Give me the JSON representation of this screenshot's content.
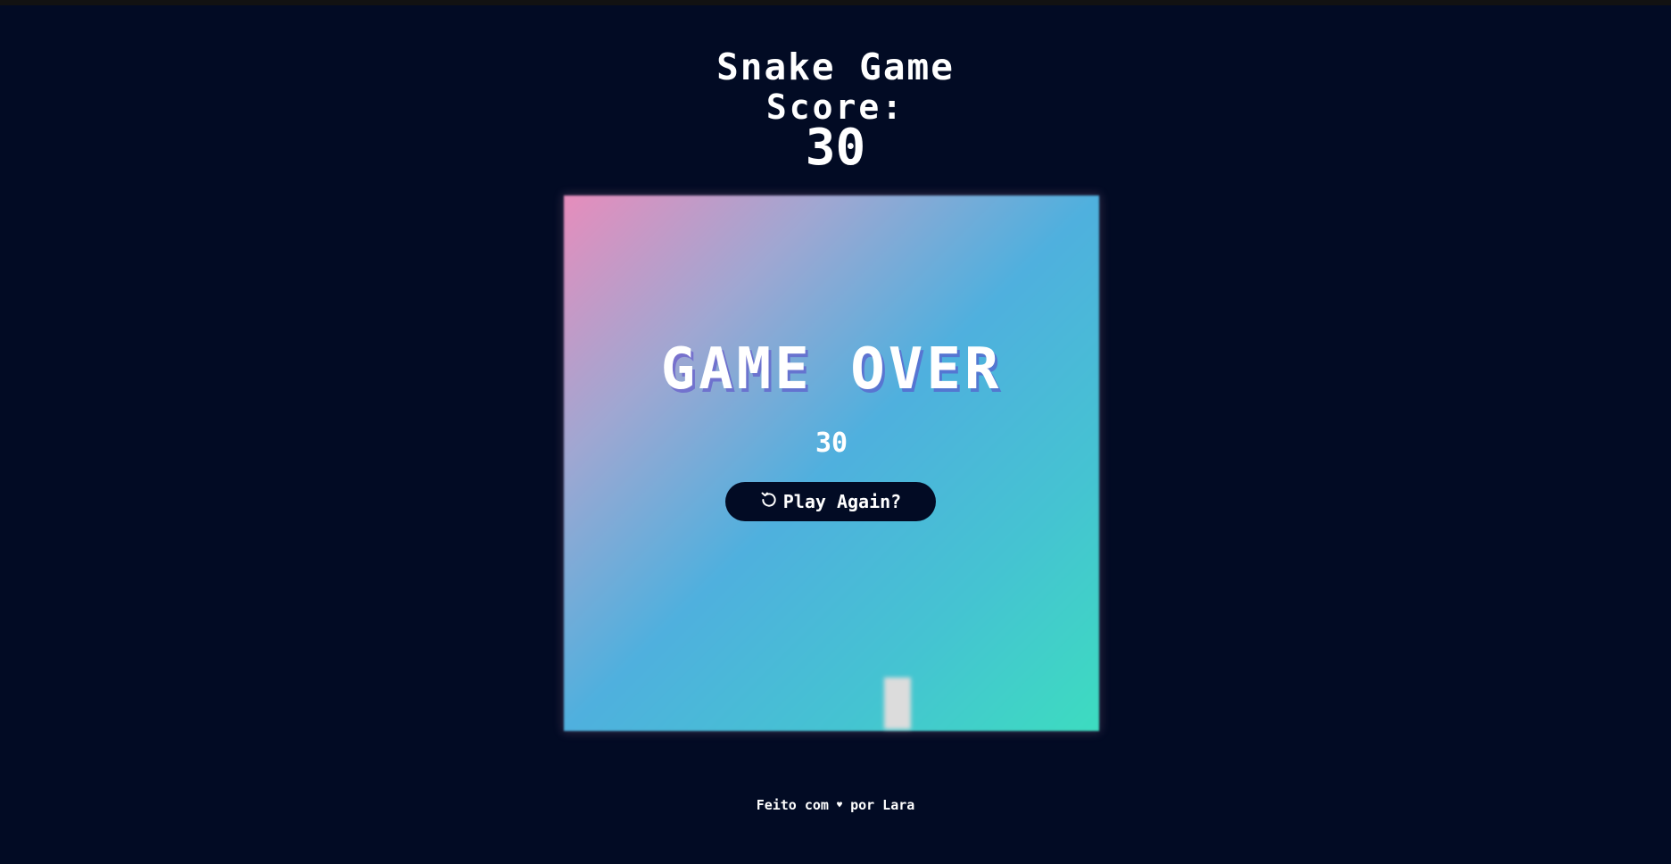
{
  "header": {
    "title": "Snake Game",
    "score_label": "Score:",
    "score_value": "30"
  },
  "overlay": {
    "game_over": "GAME OVER",
    "final_score": "30",
    "play_again_label": "Play Again?",
    "play_again_icon": "restart-icon"
  },
  "footer": {
    "text_before": "Feito com",
    "heart_icon": "heart-icon",
    "text_after": "por Lara"
  },
  "colors": {
    "background": "#020b24",
    "board_gradient_start": "#e68dbc",
    "board_gradient_mid": "#4fb0de",
    "board_gradient_end": "#3ddcc0",
    "snake": "#dcdcdc",
    "button_bg": "#020b24",
    "text": "#ffffff"
  }
}
